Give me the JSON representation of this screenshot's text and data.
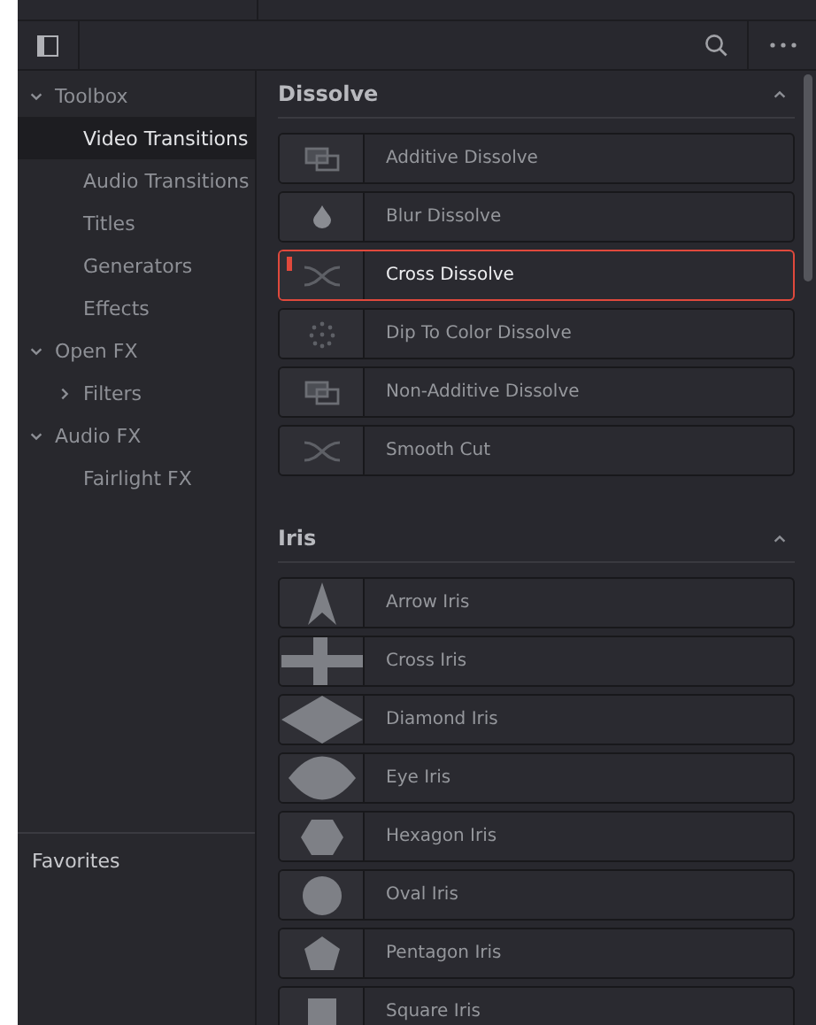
{
  "sidebar": {
    "tree": [
      {
        "label": "Toolbox",
        "expanded": true,
        "selected": false,
        "children": [
          {
            "label": "Video Transitions",
            "selected": true
          },
          {
            "label": "Audio Transitions",
            "selected": false
          },
          {
            "label": "Titles",
            "selected": false
          },
          {
            "label": "Generators",
            "selected": false
          },
          {
            "label": "Effects",
            "selected": false
          }
        ]
      },
      {
        "label": "Open FX",
        "expanded": true,
        "selected": false,
        "children": [
          {
            "label": "Filters",
            "expanded": false,
            "selected": false
          }
        ]
      },
      {
        "label": "Audio FX",
        "expanded": true,
        "selected": false,
        "children": [
          {
            "label": "Fairlight FX",
            "selected": false
          }
        ]
      }
    ],
    "favorites": "Favorites"
  },
  "sections": [
    {
      "title": "Dissolve",
      "expanded": true,
      "items": [
        {
          "label": "Additive Dissolve",
          "kind": "overlap",
          "selected": false
        },
        {
          "label": "Blur Dissolve",
          "kind": "drop",
          "selected": false
        },
        {
          "label": "Cross Dissolve",
          "kind": "curves",
          "selected": true
        },
        {
          "label": "Dip To Color Dissolve",
          "kind": "dots",
          "selected": false
        },
        {
          "label": "Non-Additive Dissolve",
          "kind": "overlap",
          "selected": false
        },
        {
          "label": "Smooth Cut",
          "kind": "curves",
          "selected": false
        }
      ]
    },
    {
      "title": "Iris",
      "expanded": true,
      "items": [
        {
          "label": "Arrow Iris",
          "kind": "arrow",
          "selected": false
        },
        {
          "label": "Cross Iris",
          "kind": "plus",
          "selected": false
        },
        {
          "label": "Diamond Iris",
          "kind": "diamond",
          "selected": false
        },
        {
          "label": "Eye Iris",
          "kind": "eye",
          "selected": false
        },
        {
          "label": "Hexagon Iris",
          "kind": "hexagon",
          "selected": false
        },
        {
          "label": "Oval Iris",
          "kind": "circle",
          "selected": false
        },
        {
          "label": "Pentagon Iris",
          "kind": "pentagon",
          "selected": false
        },
        {
          "label": "Square Iris",
          "kind": "square",
          "selected": false
        }
      ]
    }
  ]
}
